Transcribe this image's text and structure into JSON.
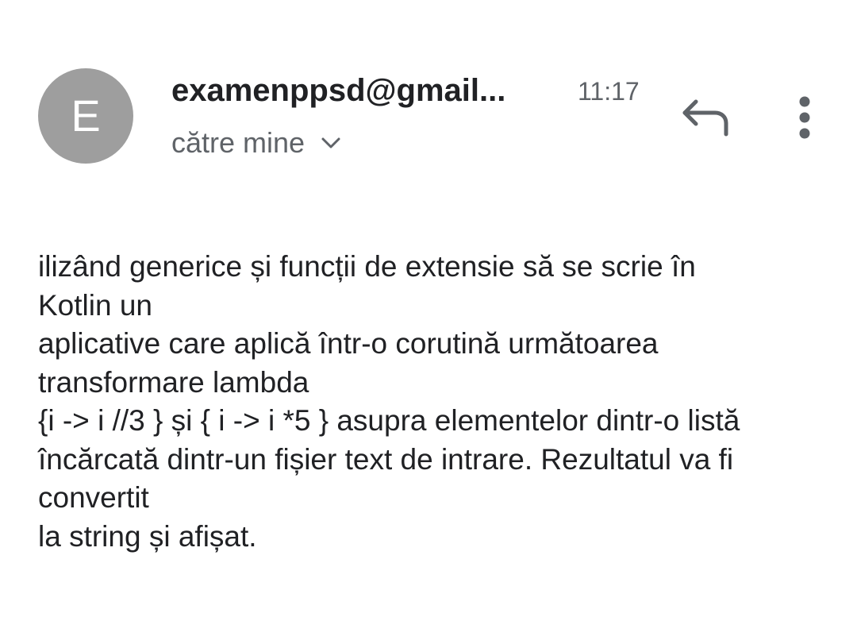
{
  "header": {
    "avatar_letter": "E",
    "sender": "examenppsd@gmail...",
    "time": "11:17",
    "recipient_label": "către mine"
  },
  "icons": {
    "recipient_toggle": "chevron-down-icon",
    "reply": "reply-icon",
    "more": "more-vert-icon"
  },
  "colors": {
    "avatar_bg": "#9e9e9e",
    "primary_text": "#202124",
    "secondary_text": "#5f6368"
  },
  "message": {
    "lines": [
      "ilizând generice și funcții de extensie să se scrie în",
      "Kotlin un",
      "aplicative care aplică într-o corutină următoarea",
      "transformare lambda",
      "{i -> i //3 } și { i -> i *5 } asupra elementelor dintr-o listă",
      "încărcată dintr-un fișier text de intrare. Rezultatul va fi",
      "convertit",
      "la string și afișat."
    ]
  }
}
